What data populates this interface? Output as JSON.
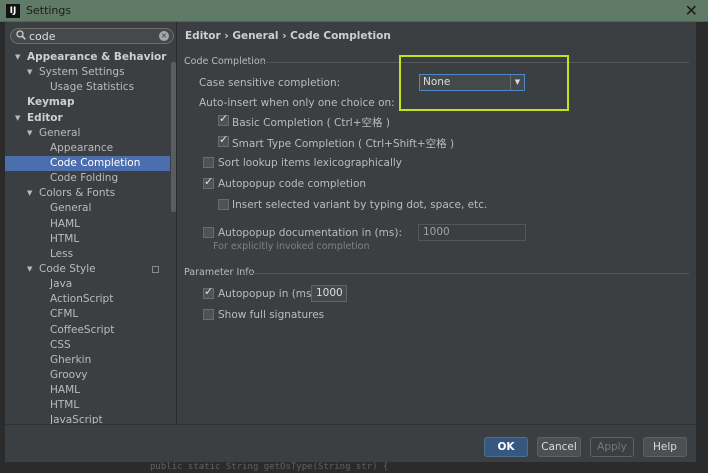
{
  "window": {
    "title": "Settings",
    "logo": "IJ"
  },
  "search": {
    "value": "code",
    "clear_glyph": "×"
  },
  "tree": [
    {
      "label": "Appearance & Behavior",
      "level": 0,
      "arrow": "down",
      "bold": true
    },
    {
      "label": "System Settings",
      "level": 1,
      "arrow": "down",
      "bold": false
    },
    {
      "label": "Usage Statistics",
      "level": 2,
      "arrow": "",
      "bold": false
    },
    {
      "label": "Keymap",
      "level": 0,
      "arrow": "",
      "bold": true
    },
    {
      "label": "Editor",
      "level": 0,
      "arrow": "down",
      "bold": true
    },
    {
      "label": "General",
      "level": 1,
      "arrow": "down",
      "bold": false
    },
    {
      "label": "Appearance",
      "level": 2,
      "arrow": "",
      "bold": false
    },
    {
      "label": "Code Completion",
      "level": 2,
      "arrow": "",
      "bold": false,
      "selected": true
    },
    {
      "label": "Code Folding",
      "level": 2,
      "arrow": "",
      "bold": false
    },
    {
      "label": "Colors & Fonts",
      "level": 1,
      "arrow": "down",
      "bold": false
    },
    {
      "label": "General",
      "level": 2,
      "arrow": "",
      "bold": false
    },
    {
      "label": "HAML",
      "level": 2,
      "arrow": "",
      "bold": false
    },
    {
      "label": "HTML",
      "level": 2,
      "arrow": "",
      "bold": false
    },
    {
      "label": "Less",
      "level": 2,
      "arrow": "",
      "bold": false
    },
    {
      "label": "Code Style",
      "level": 1,
      "arrow": "down",
      "bold": false,
      "badge": true
    },
    {
      "label": "Java",
      "level": 2,
      "arrow": "",
      "bold": false
    },
    {
      "label": "ActionScript",
      "level": 2,
      "arrow": "",
      "bold": false
    },
    {
      "label": "CFML",
      "level": 2,
      "arrow": "",
      "bold": false
    },
    {
      "label": "CoffeeScript",
      "level": 2,
      "arrow": "",
      "bold": false
    },
    {
      "label": "CSS",
      "level": 2,
      "arrow": "",
      "bold": false
    },
    {
      "label": "Gherkin",
      "level": 2,
      "arrow": "",
      "bold": false
    },
    {
      "label": "Groovy",
      "level": 2,
      "arrow": "",
      "bold": false
    },
    {
      "label": "HAML",
      "level": 2,
      "arrow": "",
      "bold": false
    },
    {
      "label": "HTML",
      "level": 2,
      "arrow": "",
      "bold": false
    },
    {
      "label": "JavaScript",
      "level": 2,
      "arrow": "",
      "bold": false
    }
  ],
  "breadcrumb": "Editor › General › Code Completion",
  "code_completion": {
    "group_title": "Code Completion",
    "case_label": "Case sensitive completion:",
    "case_value": "None",
    "auto_insert_label": "Auto-insert when only one choice on:",
    "basic_label": "Basic Completion ( Ctrl+空格 )",
    "basic_checked": true,
    "smart_label": "Smart Type Completion ( Ctrl+Shift+空格 )",
    "smart_checked": true,
    "sort_label": "Sort lookup items lexicographically",
    "sort_checked": false,
    "autopopup_label": "Autopopup code completion",
    "autopopup_checked": true,
    "insert_variant_label": "Insert selected variant by typing dot, space, etc.",
    "insert_variant_checked": false,
    "doc_label": "Autopopup documentation in (ms):",
    "doc_checked": false,
    "doc_value": "1000",
    "doc_hint": "For explicitly invoked completion"
  },
  "parameter_info": {
    "group_title": "Parameter Info",
    "autopopup_label": "Autopopup in (ms):",
    "autopopup_checked": true,
    "autopopup_value": "1000",
    "full_sig_label": "Show full signatures",
    "full_sig_checked": false
  },
  "footer": {
    "ok": "OK",
    "cancel": "Cancel",
    "apply": "Apply",
    "help": "Help"
  },
  "background_code": "public static String getOsType(String str) {"
}
